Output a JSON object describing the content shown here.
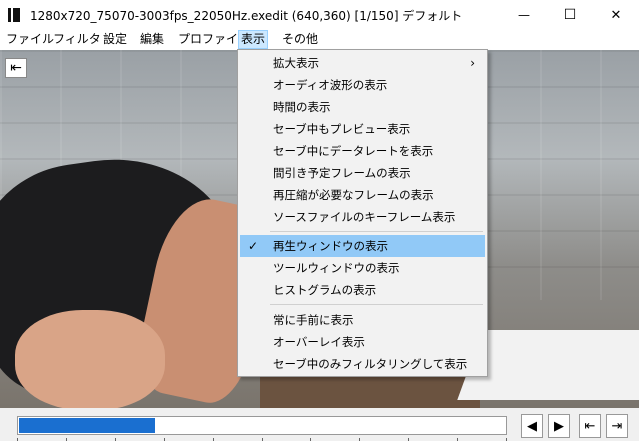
{
  "window": {
    "title": "1280x720_75070-3003fps_22050Hz.exedit (640,360)  [1/150]  デフォルト",
    "minimize_glyph": "—",
    "maximize_glyph": "☐",
    "close_glyph": "✕"
  },
  "menubar": {
    "items": [
      "ファイル",
      "フィルタ",
      "設定",
      "編集",
      "プロファイル",
      "表示",
      "その他"
    ],
    "active": "表示"
  },
  "view_menu": {
    "items": [
      {
        "label": "拡大表示",
        "submenu_glyph": "›"
      },
      {
        "label": "オーディオ波形の表示"
      },
      {
        "label": "時間の表示"
      },
      {
        "label": "セーブ中もプレビュー表示"
      },
      {
        "label": "セーブ中にデータレートを表示"
      },
      {
        "label": "間引き予定フレームの表示"
      },
      {
        "label": "再圧縮が必要なフレームの表示"
      },
      {
        "label": "ソースファイルのキーフレーム表示"
      },
      {
        "label": "再生ウィンドウの表示",
        "checked": true,
        "highlighted": true,
        "check_glyph": "✓"
      },
      {
        "label": "ツールウィンドウの表示"
      },
      {
        "label": "ヒストグラムの表示"
      },
      {
        "label": "常に手前に表示"
      },
      {
        "label": "オーバーレイ表示"
      },
      {
        "label": "セーブ中のみフィルタリングして表示"
      }
    ]
  },
  "preview": {
    "back_button_glyph": "⇤"
  },
  "playback": {
    "current_frame": 1,
    "total_frames": 150,
    "seek_fraction": 0.28,
    "buttons": [
      {
        "name": "prev-frame-button",
        "glyph": "◀"
      },
      {
        "name": "next-frame-button",
        "glyph": "▶"
      },
      {
        "name": "go-start-button",
        "glyph": "⇤"
      },
      {
        "name": "go-end-button",
        "glyph": "⇥"
      }
    ]
  },
  "colors": {
    "menu_highlight": "#91c9f7",
    "seek_fill": "#1a6fd0"
  }
}
